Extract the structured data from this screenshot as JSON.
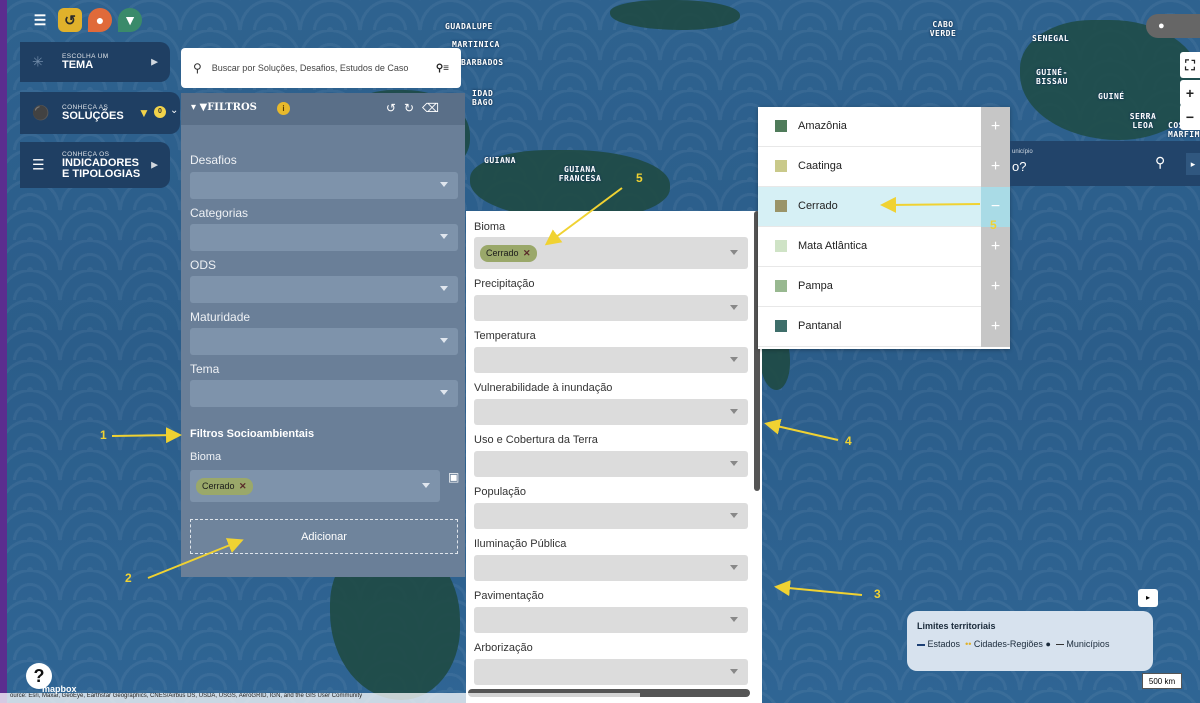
{
  "map": {
    "labels": [
      "GUADALUPE",
      "MARTINICA",
      "BARBADOS",
      "IDAD",
      "BAGO",
      "GUIANA",
      "GUIANA FRANCESA",
      "CABO VERDE",
      "SENEGAL",
      "GUINÉ-BISSAU",
      "GUINÉ",
      "SERRA LEOA",
      "COSTA MARFIM"
    ],
    "attribution": "ource: Esri, Maxar, GeoEye, Earthstar Geographics, CNES/Airbus DS, USDA, USGS, AeroGRID, IGN, and the GIS User Community",
    "brand": "mapbox",
    "scale": "500 km",
    "city_search_hint": "unicípio",
    "city_search_partial": "o?"
  },
  "nav": {
    "theme": {
      "small": "ESCOLHA UM",
      "big": "TEMA"
    },
    "solutions": {
      "small": "CONHEÇA AS",
      "big": "SOLUÇÕES",
      "count": "0"
    },
    "indicators": {
      "small": "CONHEÇA OS",
      "big1": "INDICADORES",
      "big2": "E TIPOLOGIAS"
    }
  },
  "search": {
    "placeholder": "Buscar por Soluções, Desafios, Estudos de Caso"
  },
  "filters": {
    "title": "FILTROS",
    "badge": "i",
    "fields": [
      "Desafios",
      "Categorias",
      "ODS",
      "Maturidade",
      "Tema"
    ],
    "socio_title": "Filtros Socioambientais",
    "bioma_label": "Bioma",
    "bioma_chip": "Cerrado",
    "add_label": "Adicionar"
  },
  "socio_panel": {
    "fields": [
      "Bioma",
      "Precipitação",
      "Temperatura",
      "Vulnerabilidade à inundação",
      "Uso e Cobertura da Terra",
      "População",
      "Iluminação Pública",
      "Pavimentação",
      "Arborização"
    ],
    "bioma_chip": "Cerrado"
  },
  "biomas": [
    {
      "name": "Amazônia",
      "color": "#4f7b5a"
    },
    {
      "name": "Caatinga",
      "color": "#c9c98a"
    },
    {
      "name": "Cerrado",
      "color": "#9a9468"
    },
    {
      "name": "Mata Atlântica",
      "color": "#cfe3c6"
    },
    {
      "name": "Pampa",
      "color": "#98b890"
    },
    {
      "name": "Pantanal",
      "color": "#3e6e6a"
    }
  ],
  "legend": {
    "title": "Limites territoriais",
    "items": [
      "Estados",
      "Cidades-Regiões",
      "Municípios"
    ]
  },
  "annotations": [
    "1",
    "2",
    "3",
    "4",
    "5",
    "5"
  ]
}
